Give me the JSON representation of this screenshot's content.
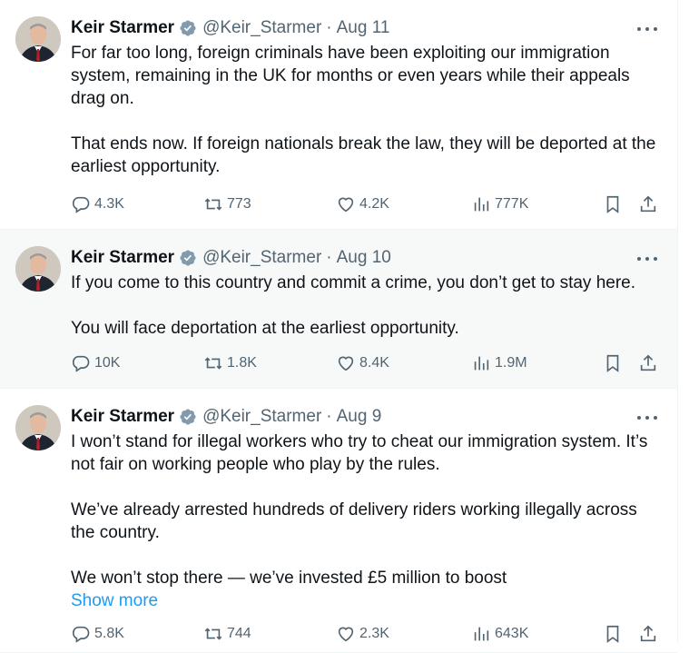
{
  "author": {
    "name": "Keir Starmer",
    "handle": "@Keir_Starmer"
  },
  "accent_color": "#1d9bf0",
  "verified_color": "#829aab",
  "tweets": [
    {
      "date": "Aug 11",
      "paragraphs": [
        "For far too long, foreign criminals have been exploiting our immigration system, remaining in the UK for months or even years while their appeals drag on.",
        "That ends now. If foreign nationals break the law, they will be deported at the earliest opportunity."
      ],
      "show_more": "",
      "replies": "4.3K",
      "reposts": "773",
      "likes": "4.2K",
      "views": "777K"
    },
    {
      "date": "Aug 10",
      "paragraphs": [
        "If you come to this country and commit a crime, you don’t get to stay here.",
        "You will face deportation at the earliest opportunity."
      ],
      "show_more": "",
      "replies": "10K",
      "reposts": "1.8K",
      "likes": "8.4K",
      "views": "1.9M"
    },
    {
      "date": "Aug 9",
      "paragraphs": [
        "I won’t stand for illegal workers who try to cheat our immigration system. It’s not fair on working people who play by the rules.",
        "We’ve already arrested hundreds of delivery riders working illegally across the country.",
        "We won’t stop there — we’ve invested £5 million to boost"
      ],
      "show_more": "Show more",
      "replies": "5.8K",
      "reposts": "744",
      "likes": "2.3K",
      "views": "643K"
    }
  ],
  "icons": {
    "reply": "reply-icon",
    "repost": "repost-icon",
    "like": "heart-icon",
    "views": "views-icon",
    "bookmark": "bookmark-icon",
    "share": "share-icon",
    "more": "more-icon",
    "verified": "verified-badge-icon"
  }
}
